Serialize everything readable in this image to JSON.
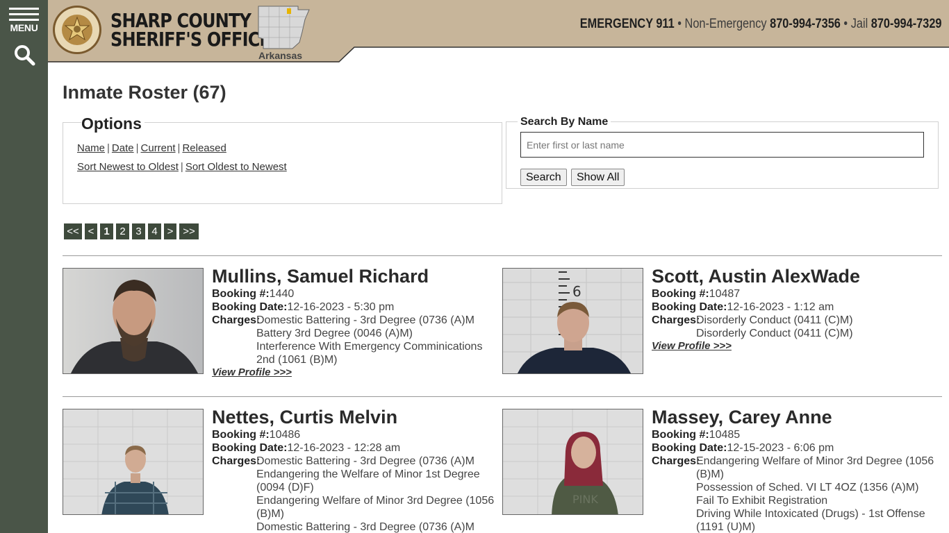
{
  "nav": {
    "menu_label": "MENU",
    "search_icon": "search-icon",
    "menu_icon": "hamburger-icon"
  },
  "header": {
    "title_line1": "SHARP COUNTY",
    "title_line2": "SHERIFF'S OFFICE",
    "badge_text": "SHARP COUNTY SHERIFF'S DEPARTMENT",
    "state_label": "Arkansas",
    "emergency_label": "EMERGENCY 911",
    "nonemergency_label": "Non-Emergency",
    "nonemergency_number": "870-994-7356",
    "jail_label": "Jail",
    "jail_number": "870-994-7329",
    "separator": "•"
  },
  "page": {
    "title": "Inmate Roster (67)"
  },
  "options": {
    "legend": "Options",
    "row1": [
      "Name",
      "Date",
      "Current",
      "Released"
    ],
    "row2": [
      "Sort Newest to Oldest",
      "Sort Oldest to Newest"
    ],
    "sep": "|"
  },
  "search": {
    "legend": "Search By Name",
    "placeholder": "Enter first or last name",
    "value": "",
    "search_label": "Search",
    "show_all_label": "Show All"
  },
  "pager": {
    "items": [
      "<<",
      "<",
      "1",
      "2",
      "3",
      "4",
      ">",
      ">>"
    ],
    "current": "1"
  },
  "labels": {
    "booking_no": "Booking #:",
    "booking_date": "Booking Date:",
    "charges": "Charges:",
    "view_profile": "View Profile >>>"
  },
  "inmates": [
    {
      "name": "Mullins, Samuel Richard",
      "booking_no": "1440",
      "booking_date": "12-16-2023 - 5:30 pm",
      "charges": [
        "Domestic Battering - 3rd Degree (0736 (A)M",
        "Battery 3rd Degree (0046 (A)M)",
        "Interference With Emergency Comminications 2nd (1061 (B)M)"
      ]
    },
    {
      "name": "Scott, Austin AlexWade",
      "booking_no": "10487",
      "booking_date": "12-16-2023 - 1:12 am",
      "charges": [
        "Disorderly Conduct (0411 (C)M)",
        "Disorderly Conduct (0411 (C)M)"
      ]
    },
    {
      "name": "Nettes, Curtis Melvin",
      "booking_no": "10486",
      "booking_date": "12-16-2023 - 12:28 am",
      "charges": [
        "Domestic Battering - 3rd Degree (0736 (A)M",
        "Endangering the Welfare of Minor 1st Degree (0094 (D)F)",
        "Endangering Welfare of Minor 3rd Degree (1056 (B)M)",
        "Domestic Battering - 3rd Degree (0736 (A)M"
      ]
    },
    {
      "name": "Massey, Carey Anne",
      "booking_no": "10485",
      "booking_date": "12-15-2023 - 6:06 pm",
      "charges": [
        "Endangering Welfare of Minor 3rd Degree (1056 (B)M)",
        "Possession of Sched. VI LT 4OZ (1356 (A)M)",
        "Fail To Exhibit Registration",
        "Driving While Intoxicated (Drugs) - 1st Offense (1191 (U)M)"
      ]
    }
  ],
  "colors": {
    "rail": "#4a5548",
    "header_band": "#c7b59a",
    "pager": "#3e4a3c"
  }
}
